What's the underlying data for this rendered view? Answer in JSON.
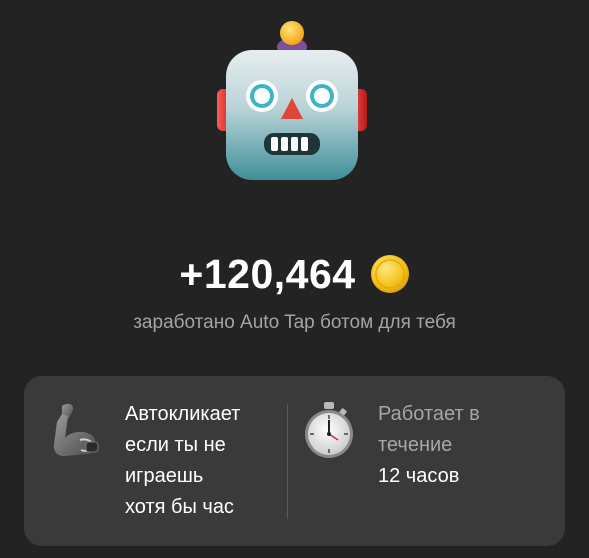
{
  "reward": {
    "amount": "+120,464",
    "subtitle": "заработано Auto Tap ботом для тебя"
  },
  "features": [
    {
      "icon": "flexed-biceps-icon",
      "lines": [
        "Автокликает",
        "если ты не",
        "играешь",
        "хотя бы час"
      ]
    },
    {
      "icon": "stopwatch-icon",
      "lines": [
        "Работает в",
        "течение",
        "12 часов"
      ]
    }
  ],
  "colors": {
    "background": "#232323",
    "card": "#3a3a3a",
    "muted_text": "#a4a4a6",
    "coin": "#f5c21a"
  }
}
